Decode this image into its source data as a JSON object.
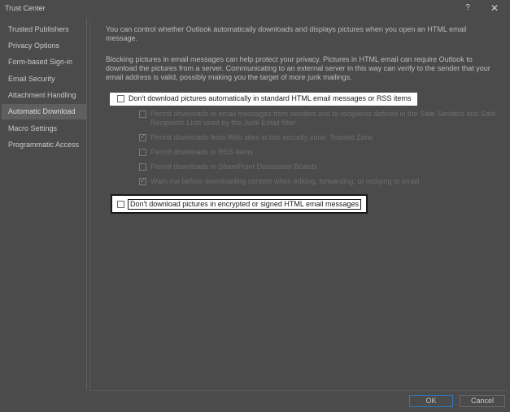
{
  "window": {
    "title": "Trust Center",
    "help_glyph": "?",
    "close_glyph": "✕"
  },
  "sidebar": {
    "items": [
      {
        "label": "Trusted Publishers"
      },
      {
        "label": "Privacy Options"
      },
      {
        "label": "Form-based Sign-in"
      },
      {
        "label": "Email Security"
      },
      {
        "label": "Attachment Handling"
      },
      {
        "label": "Automatic Download"
      },
      {
        "label": "Macro Settings"
      },
      {
        "label": "Programmatic Access"
      }
    ],
    "selected": "Automatic Download"
  },
  "content": {
    "intro": "You can control whether Outlook automatically downloads and displays pictures when you open an HTML email message.",
    "privacy": "Blocking pictures in email messages can help protect your privacy. Pictures in HTML email can require Outlook to download the pictures from a server. Communicating to an external server in this way can verify to the sender that your email address is valid, possibly making you the target of more junk mailings.",
    "main_option": {
      "label": "Don't download pictures automatically in standard HTML email messages or RSS items",
      "checked": false
    },
    "sub_options": [
      {
        "label": "Permit downloads in email messages from senders and to recipients defined in the Safe Senders and Safe Recipients Lists used by the Junk Email filter",
        "checked": false
      },
      {
        "label": "Permit downloads from Web sites in this security zone: Trusted Zone",
        "checked": true
      },
      {
        "label": "Permit downloads in RSS items",
        "checked": false
      },
      {
        "label": "Permit downloads in SharePoint Discussion Boards",
        "checked": false
      },
      {
        "label": "Warn me before downloading content when editing, forwarding, or replying to email",
        "checked": true
      }
    ],
    "encrypted_option": {
      "label": "Don't download pictures in encrypted or signed HTML email messages",
      "checked": false
    }
  },
  "buttons": {
    "ok": "OK",
    "cancel": "Cancel"
  },
  "colors": {
    "background": "#4b4b4b",
    "highlight": "#ffffff",
    "ok_border": "#2f79c4"
  }
}
